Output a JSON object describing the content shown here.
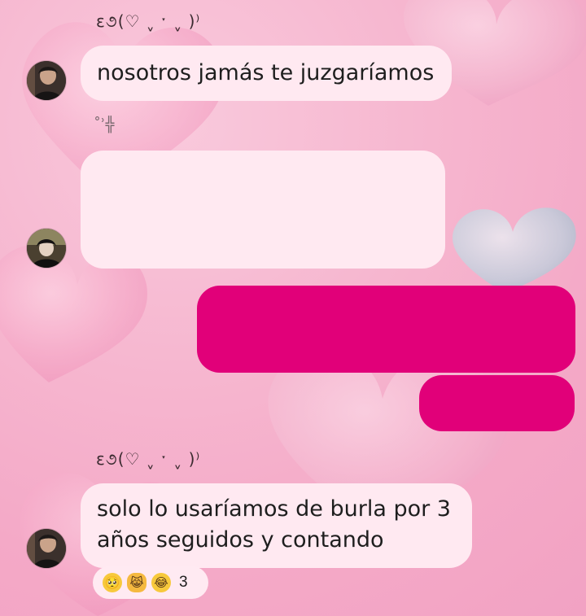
{
  "colors": {
    "incoming_bubble": "#ffe9f1",
    "outgoing_bubble": "#e10079",
    "background": "#f6b6cf"
  },
  "messages": [
    {
      "sender_name": "ε૭(♡ ˬ ˑ ˬ )⁾",
      "text": "nosotros jamás te juzgaríamos"
    },
    {
      "sticker": "˚ʾ╬"
    },
    {
      "sender_name": "ε૭(♡ ˬ ˑ ˬ )⁾",
      "line1": "solo lo usaríamos de burla por 3",
      "line2": "años seguidos y contando",
      "reactions": {
        "emoji1": "🥺",
        "emoji2": "😹",
        "emoji3": "😂",
        "count": "3"
      }
    }
  ]
}
